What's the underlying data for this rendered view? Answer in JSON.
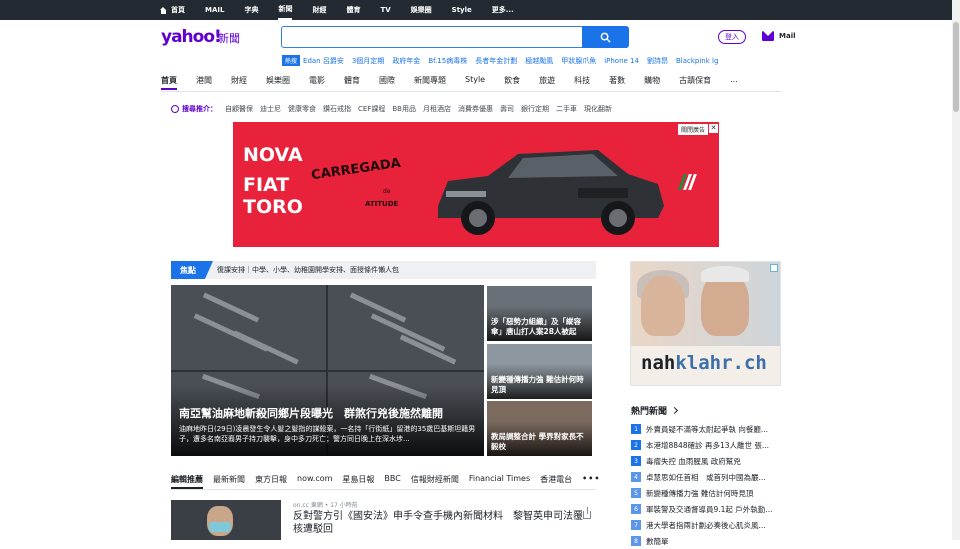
{
  "topbar": {
    "items": [
      {
        "label": "首頁",
        "active": false
      },
      {
        "label": "MAIL",
        "active": false
      },
      {
        "label": "字典",
        "active": false
      },
      {
        "label": "新聞",
        "active": true
      },
      {
        "label": "財經",
        "active": false
      },
      {
        "label": "體育",
        "active": false
      },
      {
        "label": "TV",
        "active": false
      },
      {
        "label": "娛樂圈",
        "active": false
      },
      {
        "label": "Style",
        "active": false
      },
      {
        "label": "更多...",
        "active": false
      }
    ]
  },
  "header": {
    "logo": "yahoo!",
    "logo_sub": "新聞",
    "search_placeholder": "",
    "login_label": "登入",
    "mail_label": "Mail"
  },
  "trending": {
    "hot_label": "熱搜",
    "items": [
      "Edan 呂爵安",
      "3個月定期",
      "政府年金",
      "Bf.15病毒株",
      "長者年金計劃",
      "極越颱風",
      "甲狀腺爪魚",
      "iPhone 14",
      "劉詩昂",
      "Blackpink lg"
    ]
  },
  "nav": {
    "items": [
      "首頁",
      "港聞",
      "財經",
      "娛樂圈",
      "電影",
      "體育",
      "國際",
      "新聞專題",
      "Style",
      "飲食",
      "旅遊",
      "科技",
      "著數",
      "購物",
      "古蹟保育",
      "..."
    ],
    "active_index": 0
  },
  "recommend": {
    "label": "搜尋推介：",
    "items": [
      "自顧醫保",
      "迪士尼",
      "健康零食",
      "鑽石戒指",
      "CEF課程",
      "BB用品",
      "月租酒店",
      "消費券優惠",
      "壽司",
      "銀行定期",
      "二手車",
      "現化翻新"
    ]
  },
  "banner_ad": {
    "line1": "NOVA",
    "line2": "FIAT TORO",
    "tagline": "CARREGADA",
    "de": "de",
    "atitude": "ATITUDE",
    "ad_label": "關閉廣告",
    "close": "✕",
    "stripe_colors": [
      "#1a8f3c",
      "#ffffff",
      "#ffffff",
      "#e8223b"
    ]
  },
  "focus": {
    "tag": "焦點",
    "text": "復課安排｜中學、小學、幼稚園開學安排、面授條件懶人包"
  },
  "hero": {
    "title": "南亞幫油麻地斬殺同鄉片段曝光　群煞行兇後施然離開",
    "summary": "油麻地昨日(29日)凌晨發生令人髮之髮指的謀殺案，一名持「行街紙」留港的35歲巴基斯坦籍男子，遭多名南亞裔男子持刀襲擊，身中多刀死亡；警方同日晚上在深水埗..."
  },
  "side_stories": [
    {
      "title": "涉「惡勢力組織」及「縱容傘」唐山打人案28人被起"
    },
    {
      "title": "新變種傳播力強 難估計何時見頂"
    },
    {
      "title": "教局調整合計 學界對家長不毅校"
    }
  ],
  "tabs": {
    "items": [
      "編輯推薦",
      "最新新聞",
      "東方日報",
      "now.com",
      "星島日報",
      "BBC",
      "信報財經新聞",
      "Financial Times",
      "香港電台"
    ],
    "active_index": 0,
    "more": "•••"
  },
  "article": {
    "source": "on.cc 東網 • 17 小時前",
    "title": "反對警方引《國安法》申手令查手機內新聞材料　黎智英申司法覆核遭駁回"
  },
  "right_ad": {
    "brand_a": "nah",
    "brand_b": "klahr.ch"
  },
  "hot_news": {
    "title": "熱門新聞",
    "items": [
      "外賣員疑不滿等太耐起爭執 向餐廳...",
      "本港增8848確診 再多13人離世 張...",
      "毒瘤失控 血雨腥風 政府幫兇",
      "卓慧思如任首相　或首列中國為嚴...",
      "新變種傳播力強 難估計何時見頂",
      "軍裝警及交通督導員9.1起 戶外執勤...",
      "港大學者指兩計劃必奏後心肌炎風...",
      "數簡單"
    ]
  }
}
